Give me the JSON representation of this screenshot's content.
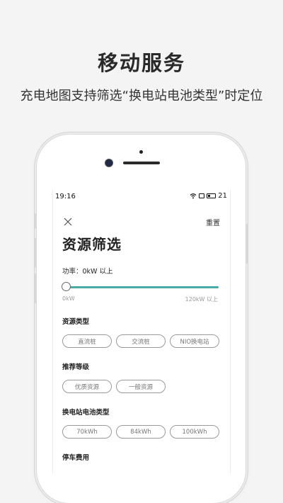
{
  "hero": {
    "title": "移动服务",
    "subtitle": "充电地图支持筛选“换电站电池类型”时定位"
  },
  "status_bar": {
    "time": "19:16",
    "battery": "21",
    "icons": [
      "wifi-icon",
      "box-icon",
      "battery-icon"
    ]
  },
  "filter": {
    "reset_label": "重置",
    "close_icon": "close-icon",
    "title": "资源筛选",
    "power": {
      "label": "功率：0kW 以上",
      "min_label": "0kW",
      "max_label": "120kW 以上",
      "value_fraction": 0.0
    },
    "resource_type": {
      "label": "资源类型",
      "options": [
        "直流桩",
        "交流桩",
        "NIO换电站"
      ]
    },
    "recommend": {
      "label": "推荐等级",
      "options": [
        "优质资源",
        "一般资源"
      ]
    },
    "battery_type": {
      "label": "换电站电池类型",
      "options": [
        "70kWh",
        "84kWh",
        "100kWh"
      ]
    },
    "parking": {
      "label": "停车费用"
    }
  },
  "colors": {
    "accent": "#4aa9a9",
    "background": "#f4f4f4"
  }
}
